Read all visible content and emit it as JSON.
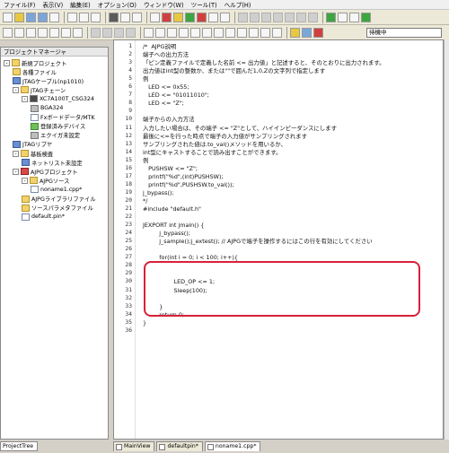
{
  "menu": [
    "ファイル(F)",
    "表示(V)",
    "編集(E)",
    "オプション(O)",
    "ウィンドウ(W)",
    "ツール(T)",
    "ヘルプ(H)"
  ],
  "toolbar": {
    "status_value": "待機中"
  },
  "project_manager": {
    "title": "プロジェクトマネージャ",
    "tree": [
      {
        "label": "新規プロジェクト",
        "level": 0,
        "expander": "-",
        "icon": "folder"
      },
      {
        "label": "各種ファイル",
        "level": 1,
        "expander": "",
        "icon": "folder"
      },
      {
        "label": "JTAGケーブル(np1010)",
        "level": 1,
        "expander": "",
        "icon": "blue"
      },
      {
        "label": "JTAGチェーン",
        "level": 1,
        "expander": "-",
        "icon": "folder"
      },
      {
        "label": "XC7A100T_CSG324",
        "level": 2,
        "expander": "-",
        "icon": "chip"
      },
      {
        "label": "BGA324",
        "level": 3,
        "expander": "",
        "icon": "gray"
      },
      {
        "label": "Fxボードデータ/MTK",
        "level": 3,
        "expander": "",
        "icon": "file"
      },
      {
        "label": "登録済みデバイス",
        "level": 3,
        "expander": "",
        "icon": "green"
      },
      {
        "label": "エクイガ未設定",
        "level": 3,
        "expander": "",
        "icon": "gray"
      },
      {
        "label": "JTAGリプヤ",
        "level": 1,
        "expander": "",
        "icon": "blue"
      },
      {
        "label": "基板検査",
        "level": 1,
        "expander": "-",
        "icon": "folder"
      },
      {
        "label": "ネットリスト未設定",
        "level": 2,
        "expander": "",
        "icon": "blue"
      },
      {
        "label": "AJPGプロジェクト",
        "level": 1,
        "expander": "-",
        "icon": "red"
      },
      {
        "label": "AJPGソース",
        "level": 2,
        "expander": "-",
        "icon": "folder"
      },
      {
        "label": "noname1.cpp*",
        "level": 3,
        "expander": "",
        "icon": "file"
      },
      {
        "label": "AJPGライブラリファイル",
        "level": 2,
        "expander": "",
        "icon": "folder"
      },
      {
        "label": "ソースパラメタファイル",
        "level": 2,
        "expander": "",
        "icon": "folder"
      },
      {
        "label": "default.pin*",
        "level": 2,
        "expander": "",
        "icon": "file"
      }
    ]
  },
  "bottom_tab_project": "ProjectTree",
  "editor": {
    "lines": [
      "/*  AJPG説明",
      "端子への出力方法",
      "「ピン定義ファイルで定義した名前 <= 出力値」と記述すると、そのとおりに出力されます。",
      "出力値はint型の整数か、または\"\"で囲んだ1,0,Zの文字列で指定します",
      "例",
      "   LED <= 0x55;",
      "   LED <= \"01011010\";",
      "   LED <= \"Z\";",
      "",
      "端子からの入力方法",
      "入力したい場合は、その端子 <= \"Z\"として、ハイインピーダンスにします",
      "最後に<=を行った時点で端子の入力値がサンプリングされます",
      "サンプリングされた値は.to_val()メソッドを用いるか、",
      "int型にキャストすることで読み出すことができます。",
      "例",
      "   PUSHSW <= \"Z\";",
      "   printf(\"%d\",(int)PUSHSW);",
      "   printf(\"%d\",PUSHSW.to_val());",
      "j_bypass();",
      "*/",
      "#include \"default.h\"",
      "",
      "JEXPORT int jmain() {",
      "         j_bypass();",
      "         j_sample();j_extest(); // AJPGで端子を操作するにはこの行を有効にしてください",
      "",
      "         for(int i = 0; i < 100; i++){",
      "",
      "",
      "                 LED_OP <= 1;",
      "                 Sleep(100);",
      "",
      "         }",
      "         return 0;",
      "}",
      ""
    ]
  },
  "tabs": [
    {
      "label": "MainView",
      "active": false
    },
    {
      "label": "defaultpin*",
      "active": false
    },
    {
      "label": "noname1.cpp*",
      "active": true
    }
  ],
  "colors": {
    "highlight": "#d9203a"
  }
}
